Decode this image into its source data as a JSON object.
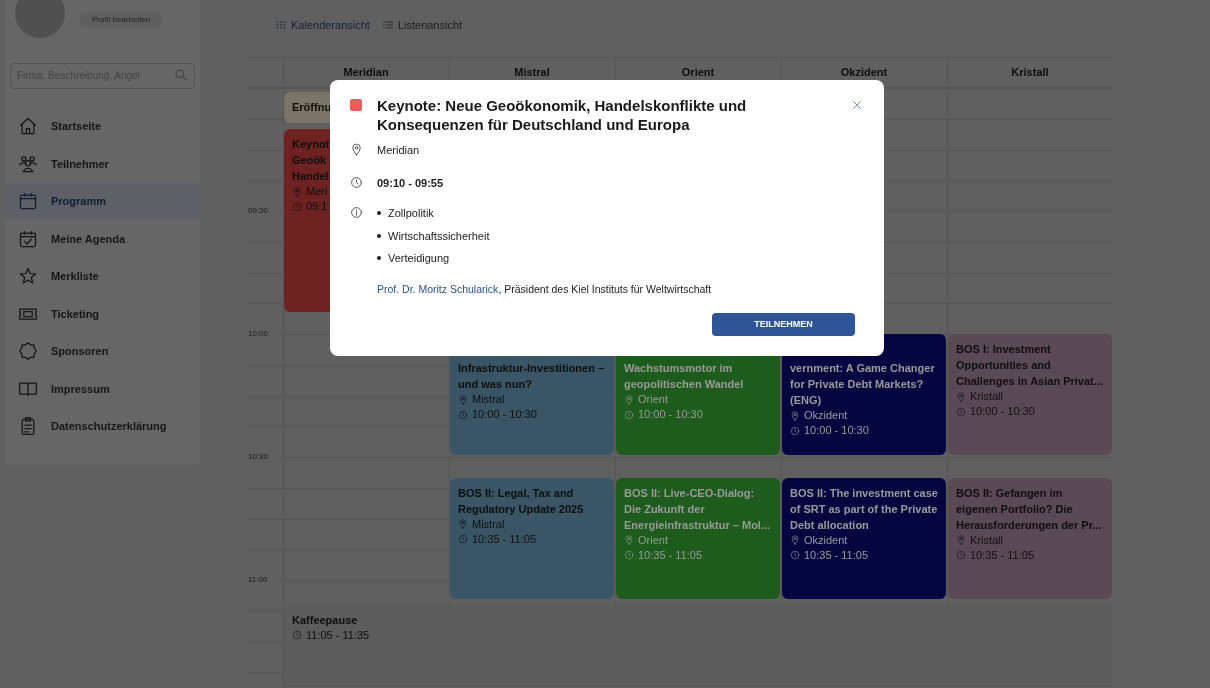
{
  "sidebar": {
    "profile_button": "Profil bearbeiten",
    "search": {
      "placeholder": "Firma, Beschreibung, Angel"
    },
    "items": [
      {
        "label": "Startseite",
        "selected": false
      },
      {
        "label": "Teilnehmer",
        "selected": false
      },
      {
        "label": "Programm",
        "selected": true
      },
      {
        "label": "Meine Agenda",
        "selected": false
      },
      {
        "label": "Merkliste",
        "selected": false
      },
      {
        "label": "Ticketing",
        "selected": false
      },
      {
        "label": "Sponsoren",
        "selected": false
      },
      {
        "label": "Impressum",
        "selected": false
      },
      {
        "label": "Datenschutzerklärung",
        "selected": false
      }
    ]
  },
  "views": [
    {
      "label": "Kalenderansicht",
      "selected": true
    },
    {
      "label": "Listenansicht",
      "selected": false
    }
  ],
  "calendar": {
    "columns": [
      "Meridian",
      "Mistral",
      "Orient",
      "Okzident",
      "Kristall"
    ],
    "time_labels": [
      "09:30",
      "10:00",
      "10:30",
      "11:00"
    ],
    "events": [
      {
        "kind": "light",
        "color": "#7a7566",
        "title": "Eröffnu"
      },
      {
        "kind": "light",
        "color": "#6e2222",
        "title": "Keynot\nGeoök\nHandel",
        "room": "Meri",
        "time": "09:1"
      },
      {
        "kind": "light",
        "color": "#3a5566",
        "title": "Infrastruktur-Investitionen – und was nun?",
        "room": "Mistral",
        "time": "10:00 - 10:30"
      },
      {
        "kind": "dark",
        "color": "#1e5c1e",
        "title": "Wachstumsmotor im geopolitischen Wandel",
        "room": "Orient",
        "time": "10:00 - 10:30"
      },
      {
        "kind": "dark",
        "color": "#050540",
        "title": "vernment: A Game Changer for Private Debt Markets? (ENG)",
        "room": "Okzident",
        "time": "10:00 - 10:30"
      },
      {
        "kind": "light",
        "color": "#5a4a55",
        "title": "BOS I: Investment Opportunities and Challenges in Asian Privat...",
        "room": "Kristall",
        "time": "10:00 - 10:30"
      },
      {
        "kind": "light",
        "color": "#3a5566",
        "title": "BOS II: Legal, Tax and Regulatory Update 2025",
        "room": "Mistral",
        "time": "10:35 - 11:05"
      },
      {
        "kind": "dark",
        "color": "#1e5c1e",
        "title": "BOS II: Live-CEO-Dialog: Die Zukunft der Energieinfrastruktur – Mol...",
        "room": "Orient",
        "time": "10:35 - 11:05"
      },
      {
        "kind": "dark",
        "color": "#050540",
        "title": "BOS II: The investment case of SRT as part of the Private Debt allocation",
        "room": "Okzident",
        "time": "10:35 - 11:05"
      },
      {
        "kind": "light",
        "color": "#5a4a55",
        "title": "BOS II: Gefangen im eigenen Portfolio? Die Herausforderungen der Pr...",
        "room": "Kristall",
        "time": "10:35 - 11:05"
      },
      {
        "kind": "light",
        "color": "#5c5c5c",
        "title": "Kaffeepause",
        "time": "11:05 - 11:35"
      }
    ]
  },
  "modal": {
    "color": "#f05a5a",
    "title": "Keynote: Neue Geoökonomik, Handelskonflikte und Konsequenzen für Deutschland und Europa",
    "location": "Meridian",
    "time": "09:10 - 09:55",
    "topics": [
      "Zollpolitik",
      "Wirtschaftssicherheit",
      "Verteidigung"
    ],
    "speaker": {
      "name": "Prof. Dr. Moritz Schularick",
      "text": ", Präsident des Kiel Instituts für Weltwirtschaft"
    },
    "button": "TEILNEHMEN"
  }
}
